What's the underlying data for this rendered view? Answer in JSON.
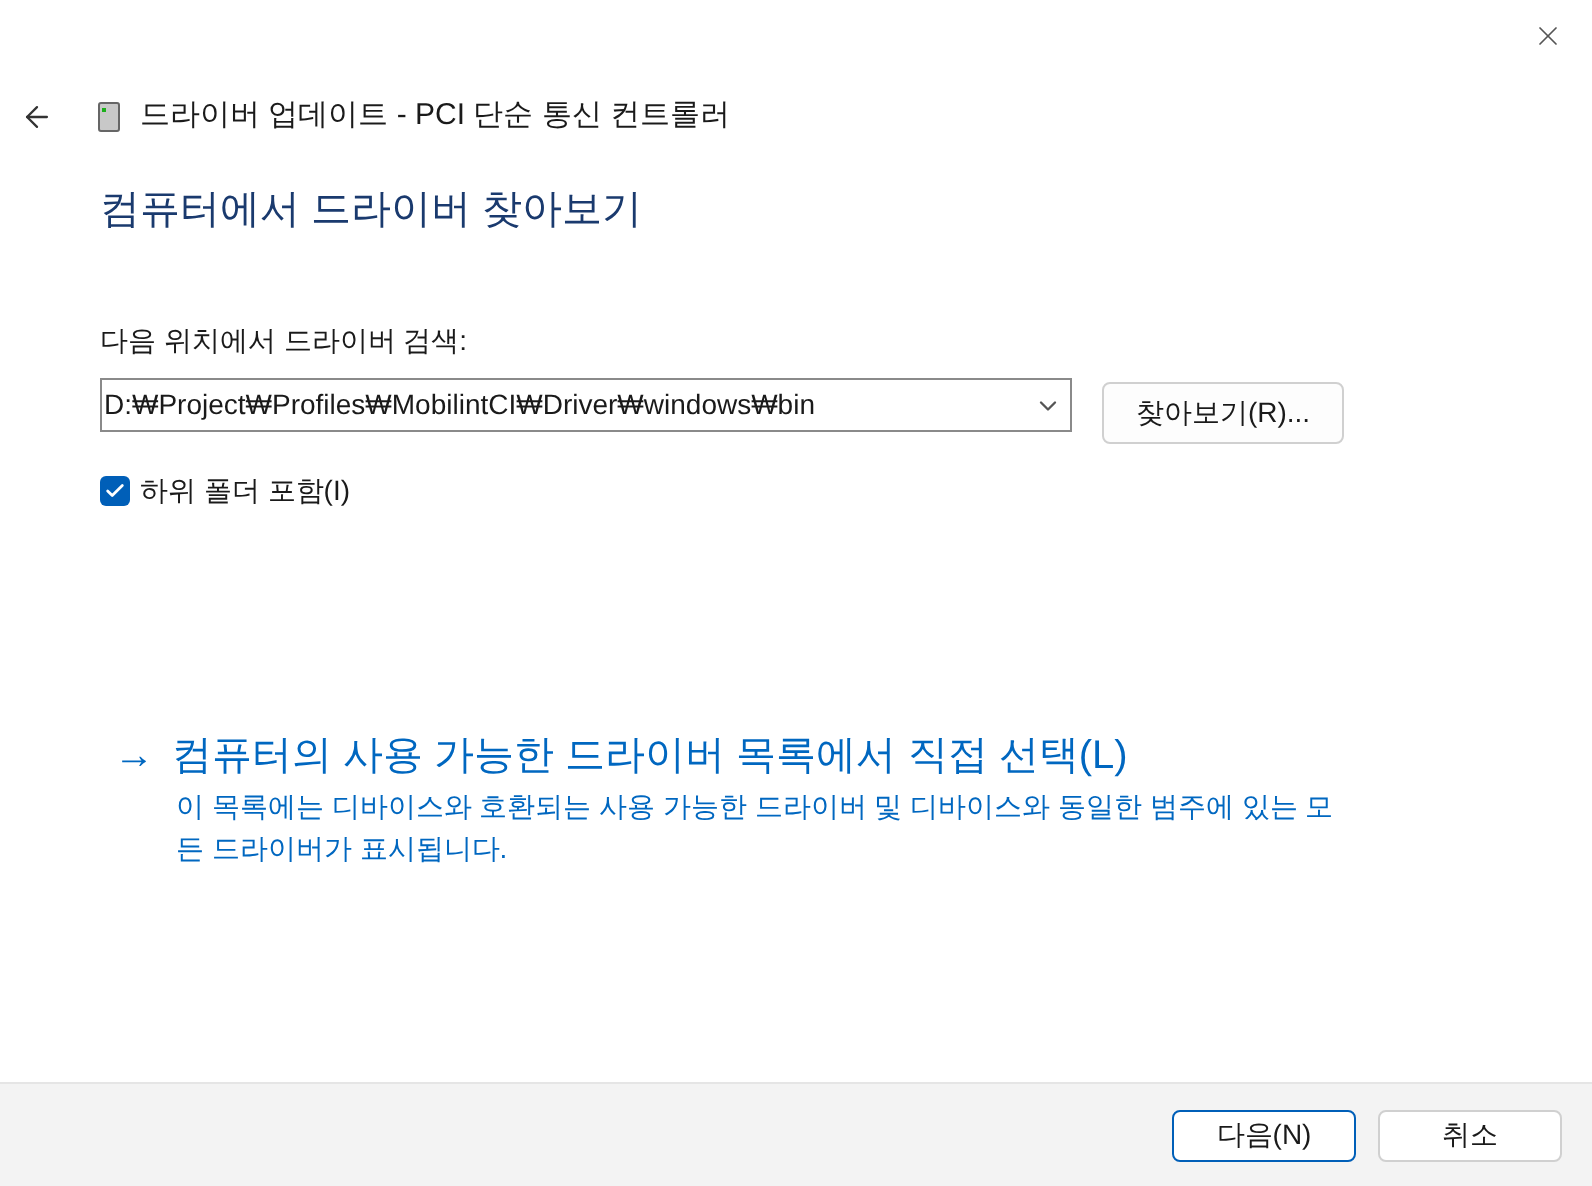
{
  "window": {
    "title": "드라이버 업데이트 - PCI 단순 통신 컨트롤러"
  },
  "heading": "컴퓨터에서 드라이버 찾아보기",
  "search": {
    "label": "다음 위치에서 드라이버 검색:",
    "value": "D:₩Project₩Profiles₩MobilintCI₩Driver₩windows₩bin",
    "browse_button": "찾아보기(R)..."
  },
  "include_subfolders": {
    "label": "하위 폴더 포함(I)",
    "checked": true
  },
  "pick_option": {
    "arrow": "→",
    "title": "컴퓨터의 사용 가능한 드라이버 목록에서 직접 선택(L)",
    "description_lines": [
      "이 목록에는 디바이스와 호환되는 사용 가능한 드라이버 및 디바이스와 동일한 범주에 있는 모",
      "든 드라이버가 표시됩니다."
    ]
  },
  "buttons": [
    {
      "label": "다음(N)",
      "kind": "primary"
    },
    {
      "label": "취소",
      "kind": "secondary"
    }
  ]
}
